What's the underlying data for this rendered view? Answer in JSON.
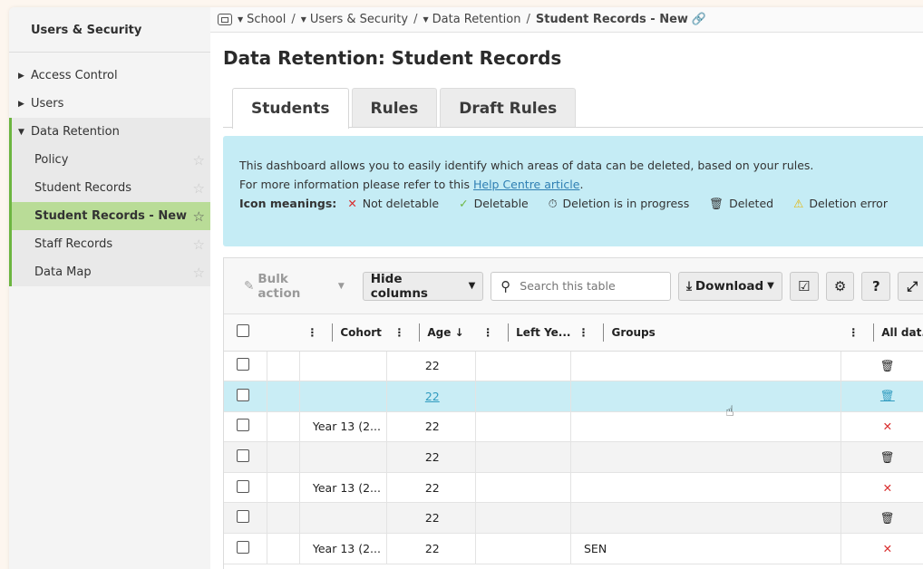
{
  "sidebar": {
    "title": "Users & Security",
    "items": [
      {
        "label": "Access Control",
        "expanded": false
      },
      {
        "label": "Users",
        "expanded": false
      },
      {
        "label": "Data Retention",
        "expanded": true
      }
    ],
    "sub_items": [
      {
        "label": "Policy",
        "active": false
      },
      {
        "label": "Student Records",
        "active": false
      },
      {
        "label": "Student Records - New",
        "active": true
      },
      {
        "label": "Staff Records",
        "active": false
      },
      {
        "label": "Data Map",
        "active": false
      }
    ]
  },
  "breadcrumb": {
    "items": [
      "School",
      "Users & Security",
      "Data Retention"
    ],
    "current": "Student Records - New",
    "separator": "/"
  },
  "page_title": "Data Retention: Student Records",
  "tabs": [
    {
      "label": "Students",
      "active": true
    },
    {
      "label": "Rules",
      "active": false
    },
    {
      "label": "Draft Rules",
      "active": false
    }
  ],
  "info": {
    "line1": "This dashboard allows you to easily identify which areas of data can be deleted, based on your rules.",
    "line2_prefix": "For more information please refer to this ",
    "link": "Help Centre article",
    "line2_suffix": ".",
    "meanings_label": "Icon meanings:",
    "meanings": [
      {
        "icon": "✕",
        "icon_name": "x-icon",
        "label": "Not deletable"
      },
      {
        "icon": "✓",
        "icon_name": "check-icon",
        "label": "Deletable"
      },
      {
        "icon": "⏱",
        "icon_name": "stopwatch-icon",
        "label": "Deletion is in progress"
      },
      {
        "icon": "🗑",
        "icon_name": "trash-icon",
        "label": "Deleted"
      },
      {
        "icon": "⚠",
        "icon_name": "warning-icon",
        "label": "Deletion error"
      }
    ]
  },
  "toolbar": {
    "bulk_action": "Bulk action",
    "hide_columns": "Hide columns",
    "search_placeholder": "Search this table",
    "download": "Download"
  },
  "table": {
    "headers": {
      "cohort": "Cohort",
      "age": "Age ↓",
      "left_year": "Left Ye...",
      "groups": "Groups",
      "all_data": "All dat..."
    },
    "rows": [
      {
        "cohort": "",
        "age": "22",
        "groups": "",
        "status": "deleted"
      },
      {
        "cohort": "",
        "age": "22",
        "groups": "",
        "status": "deleted"
      },
      {
        "cohort": "Year 13 (2...",
        "age": "22",
        "groups": "",
        "status": "not-deletable"
      },
      {
        "cohort": "",
        "age": "22",
        "groups": "",
        "status": "deleted"
      },
      {
        "cohort": "Year 13 (2...",
        "age": "22",
        "groups": "",
        "status": "not-deletable"
      },
      {
        "cohort": "",
        "age": "22",
        "groups": "",
        "status": "deleted"
      },
      {
        "cohort": "Year 13 (2...",
        "age": "22",
        "groups": "SEN",
        "status": "not-deletable"
      }
    ]
  },
  "colors": {
    "accent_green": "#6cb540",
    "active_sidebar": "#b9dc97",
    "info_bg": "#c5ecf5",
    "link": "#2f7fb3",
    "error_red": "#d92c2c"
  }
}
